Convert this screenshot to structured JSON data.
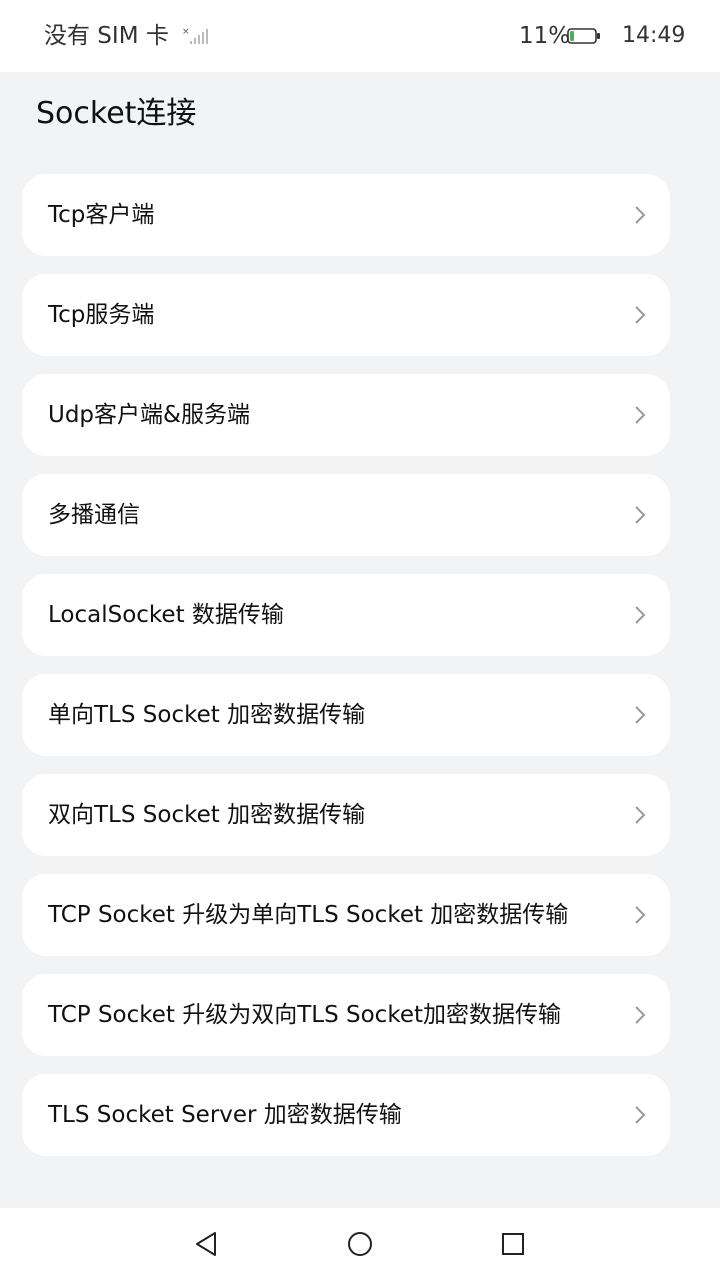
{
  "status_bar": {
    "carrier": "没有 SIM 卡",
    "battery_percent": "11%",
    "time": "14:49",
    "signal_icon": "no-signal-icon",
    "battery_icon": "battery-low-icon",
    "battery_color": "#4caf50"
  },
  "page": {
    "title": "Socket连接"
  },
  "menu": {
    "items": [
      {
        "label": "Tcp客户端",
        "icon": "chevron-right-icon"
      },
      {
        "label": "Tcp服务端",
        "icon": "chevron-right-icon"
      },
      {
        "label": "Udp客户端&服务端",
        "icon": "chevron-right-icon"
      },
      {
        "label": "多播通信",
        "icon": "chevron-right-icon"
      },
      {
        "label": "LocalSocket 数据传输",
        "icon": "chevron-right-icon"
      },
      {
        "label": "单向TLS Socket 加密数据传输",
        "icon": "chevron-right-icon"
      },
      {
        "label": "双向TLS Socket 加密数据传输",
        "icon": "chevron-right-icon"
      },
      {
        "label": "TCP Socket 升级为单向TLS Socket 加密数据传输",
        "icon": "chevron-right-icon"
      },
      {
        "label": "TCP Socket 升级为双向TLS Socket加密数据传输",
        "icon": "chevron-right-icon"
      },
      {
        "label": "TLS Socket Server 加密数据传输",
        "icon": "chevron-right-icon"
      }
    ]
  },
  "nav_bar": {
    "back_icon": "back-triangle-icon",
    "home_icon": "home-circle-icon",
    "recents_icon": "recents-square-icon"
  }
}
